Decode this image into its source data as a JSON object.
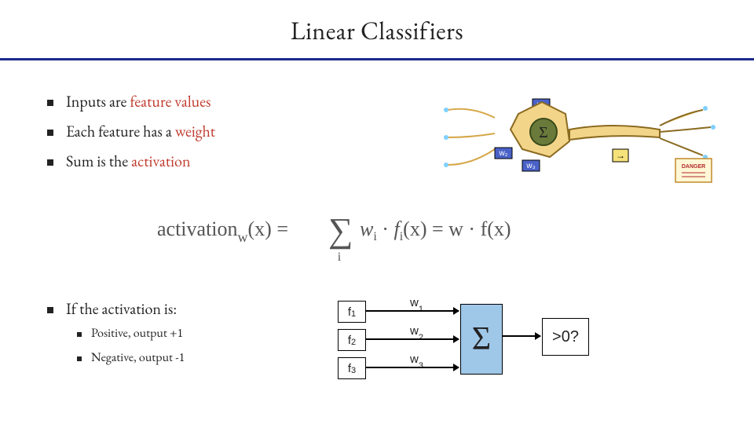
{
  "title": "Linear Classifiers",
  "bullets": {
    "b1_pre": "Inputs are ",
    "b1_red": "feature values",
    "b2_pre": "Each feature has a ",
    "b2_red": "weight",
    "b3_pre": "Sum is the ",
    "b3_red": "activation"
  },
  "formula": {
    "lhs_text": "activation",
    "lhs_sub": "w",
    "arg": "(x)",
    "eq": " = ",
    "sum_top": "",
    "sum_bot": "i",
    "rhs1_a": "w",
    "rhs1_ai": "i",
    "rhs1_dot": " · ",
    "rhs1_b": "f",
    "rhs1_bi": "i",
    "rhs1_bx": "(x)",
    "rhs2": " = w · f(x)"
  },
  "lower": {
    "main": "If the activation is:",
    "pos": "Positive, output +1",
    "neg": "Negative, output -1"
  },
  "dia": {
    "f1": "f",
    "f1s": "1",
    "f2": "f",
    "f2s": "2",
    "f3": "f",
    "f3s": "3",
    "w1": "w",
    "w1s": "1",
    "w2": "w",
    "w2s": "2",
    "w3": "w",
    "w3s": "3",
    "sum": "Σ",
    "out": ">0?"
  },
  "neuron": {
    "w1": "w₁",
    "w2": "w₂",
    "w3": "w₃",
    "sigma": "Σ",
    "arrow": "→",
    "danger": "DANGER"
  }
}
